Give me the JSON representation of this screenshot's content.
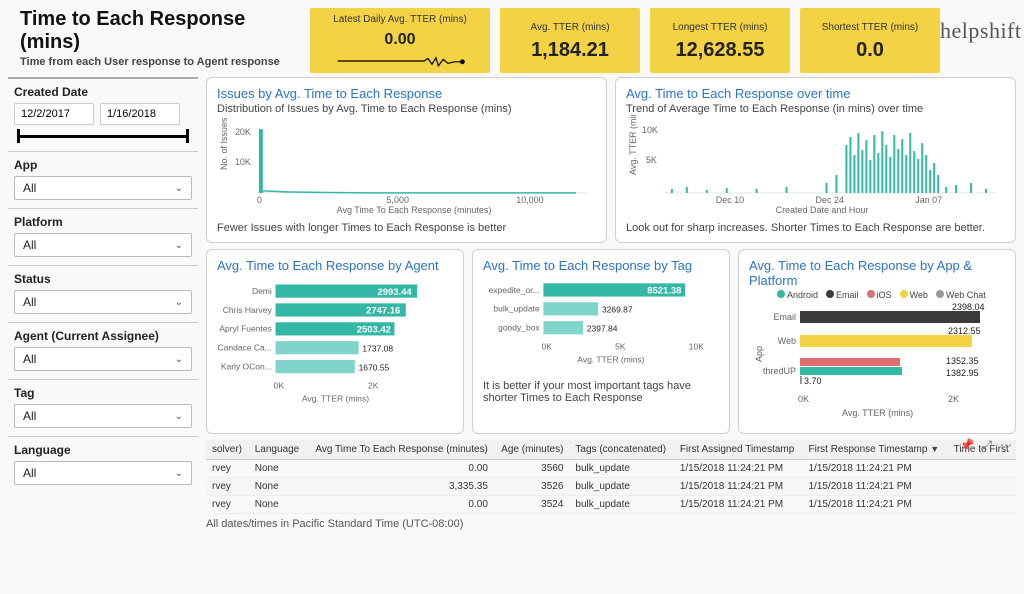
{
  "header": {
    "title": "Time to Each Response (mins)",
    "subtitle": "Time from each User response to Agent response",
    "logo": "helpshift"
  },
  "kpis": {
    "latest_label": "Latest Daily Avg. TTER (mins)",
    "latest_value": "0.00",
    "avg_label": "Avg. TTER (mins)",
    "avg_value": "1,184.21",
    "longest_label": "Longest TTER (mins)",
    "longest_value": "12,628.55",
    "shortest_label": "Shortest TTER (mins)",
    "shortest_value": "0.0"
  },
  "filters": {
    "created_date_label": "Created Date",
    "date_start": "12/2/2017",
    "date_end": "1/16/2018",
    "app_label": "App",
    "app_value": "All",
    "platform_label": "Platform",
    "platform_value": "All",
    "status_label": "Status",
    "status_value": "All",
    "agent_label": "Agent (Current Assignee)",
    "agent_value": "All",
    "tag_label": "Tag",
    "tag_value": "All",
    "language_label": "Language",
    "language_value": "All"
  },
  "cards": {
    "dist": {
      "title": "Issues by Avg. Time to Each Response",
      "subtitle": "Distribution of Issues by Avg. Time to Each Response (mins)",
      "footer": "Fewer Issues with longer Times to Each Response is better",
      "ylabel": "No. of Issues",
      "xlabel": "Avg Time To Each Response (minutes)"
    },
    "time": {
      "title": "Avg. Time to Each Response over time",
      "subtitle": "Trend of Average Time to Each Response (in mins) over time",
      "footer": "Look out for sharp increases. Shorter Times to Each Response are better.",
      "ylabel": "Avg. TTER (mins)",
      "xlabel": "Created Date and Hour"
    },
    "agent": {
      "title": "Avg. Time to Each Response by Agent",
      "xlabel": "Avg. TTER (mins)"
    },
    "tag": {
      "title": "Avg. Time to Each Response by Tag",
      "footer": "It is better if your most important tags have shorter Times to Each Response",
      "xlabel": "Avg. TTER (mins)"
    },
    "appplat": {
      "title": "Avg. Time to Each Response by App & Platform",
      "xlabel": "Avg. TTER (mins)",
      "ylabel": "App",
      "legend": {
        "android": "Android",
        "email": "Email",
        "ios": "iOS",
        "web": "Web",
        "webchat": "Web Chat"
      }
    }
  },
  "table": {
    "headers": {
      "resolver": "solver)",
      "language": "Language",
      "avg": "Avg Time To Each Response (minutes)",
      "age": "Age (minutes)",
      "tags": "Tags (concatenated)",
      "first_assigned": "First Assigned Timestamp",
      "first_response": "First Response Timestamp",
      "time_to_first": "Time to First"
    },
    "rows": [
      {
        "resolver": "rvey",
        "language": "None",
        "avg": "0.00",
        "age": "3560",
        "tags": "bulk_update",
        "first_assigned": "1/15/2018 11:24:21 PM",
        "first_response": "1/15/2018 11:24:21 PM"
      },
      {
        "resolver": "rvey",
        "language": "None",
        "avg": "3,335.35",
        "age": "3526",
        "tags": "bulk_update",
        "first_assigned": "1/15/2018 11:24:21 PM",
        "first_response": "1/15/2018 11:24:21 PM"
      },
      {
        "resolver": "rvey",
        "language": "None",
        "avg": "0.00",
        "age": "3524",
        "tags": "bulk_update",
        "first_assigned": "1/15/2018 11:24:21 PM",
        "first_response": "1/15/2018 11:24:21 PM"
      }
    ]
  },
  "footer_note": "All dates/times in Pacific Standard Time (UTC-08:00)",
  "chart_data": [
    {
      "id": "distribution",
      "type": "bar",
      "title": "Issues by Avg. Time to Each Response",
      "xlabel": "Avg Time To Each Response (minutes)",
      "ylabel": "No. of Issues",
      "xticks": [
        0,
        5000,
        10000
      ],
      "yticks": [
        10000,
        20000
      ],
      "x": [
        0,
        200,
        400,
        600,
        800,
        1000,
        1500,
        2000,
        3000,
        5000,
        7000,
        10000
      ],
      "values": [
        19000,
        1200,
        600,
        400,
        300,
        250,
        200,
        150,
        100,
        80,
        50,
        30
      ]
    },
    {
      "id": "over_time",
      "type": "bar",
      "title": "Avg. Time to Each Response over time",
      "xlabel": "Created Date and Hour",
      "ylabel": "Avg. TTER (mins)",
      "xticks": [
        "Dec 10",
        "Dec 24",
        "Jan 07"
      ],
      "yticks": [
        5000,
        10000
      ],
      "note": "Dense hourly bars; low until late Dec, spike period around Jan 01–Jan 12 reaching ~9000–10000, then drop"
    },
    {
      "id": "by_agent",
      "type": "bar",
      "orientation": "horizontal",
      "xlabel": "Avg. TTER (mins)",
      "xticks": [
        "0K",
        "2K"
      ],
      "categories": [
        "Demi",
        "Chris Harvey",
        "Apryl Fuentes",
        "Candace Ca...",
        "Karly OCon..."
      ],
      "values": [
        2993.44,
        2747.16,
        2503.42,
        1737.08,
        1670.55
      ]
    },
    {
      "id": "by_tag",
      "type": "bar",
      "orientation": "horizontal",
      "xlabel": "Avg. TTER (mins)",
      "xticks": [
        "0K",
        "5K",
        "10K"
      ],
      "categories": [
        "expedite_or...",
        "bulk_update",
        "goody_box"
      ],
      "values": [
        8521.38,
        3269.87,
        2397.84
      ]
    },
    {
      "id": "by_app_platform",
      "type": "bar",
      "orientation": "horizontal",
      "stacked": false,
      "xlabel": "Avg. TTER (mins)",
      "ylabel": "App",
      "xticks": [
        "0K",
        "2K"
      ],
      "legend": [
        "Android",
        "Email",
        "iOS",
        "Web",
        "Web Chat"
      ],
      "series": [
        {
          "app": "Email",
          "platform": "Email",
          "value": 2398.04
        },
        {
          "app": "Web",
          "platform": "Web",
          "value": 2312.55
        },
        {
          "app": "thredUP",
          "platform": "iOS",
          "value": 1352.35
        },
        {
          "app": "thredUP",
          "platform": "Android",
          "value": 1382.95
        },
        {
          "app": "thredUP",
          "platform": "Web Chat",
          "value": 3.7
        }
      ],
      "labels_visible": [
        "2398.04",
        "2312.55",
        "1352.35",
        "1382.95",
        "3.70"
      ]
    }
  ]
}
